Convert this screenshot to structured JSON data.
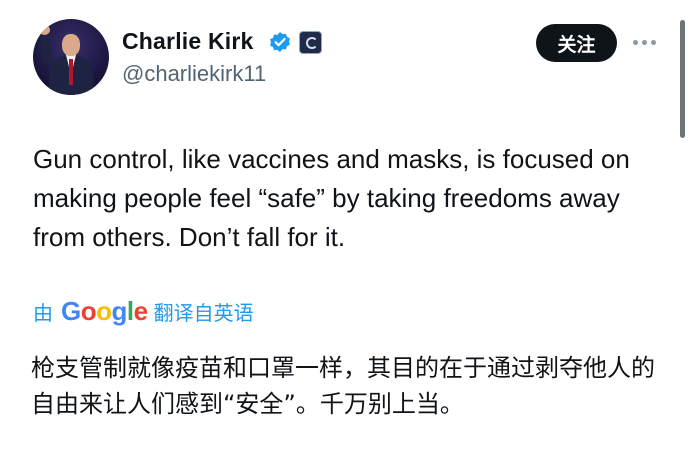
{
  "author": {
    "display_name": "Charlie Kirk",
    "handle": "@charliekirk11",
    "verified": true,
    "accent_color": "#1d9bf0"
  },
  "actions": {
    "follow_label": "关注",
    "more_icon": "ellipsis-icon"
  },
  "tweet": {
    "text": "Gun control, like vaccines and masks, is focused on making people feel “safe” by taking freedoms away from others. Don’t fall for it."
  },
  "translation": {
    "prefix": "由",
    "provider_letters": [
      "G",
      "o",
      "o",
      "g",
      "l",
      "e"
    ],
    "suffix": "翻译自英语",
    "text": "枪支管制就像疫苗和口罩一样，其目的在于通过剥夺他人的自由来让人们感到“安全”。千万别上当。"
  },
  "colors": {
    "google_blue": "#4285f4",
    "google_red": "#ea4335",
    "google_yellow": "#fbbc05",
    "google_green": "#34a853",
    "follow_bg": "#0f1419"
  }
}
